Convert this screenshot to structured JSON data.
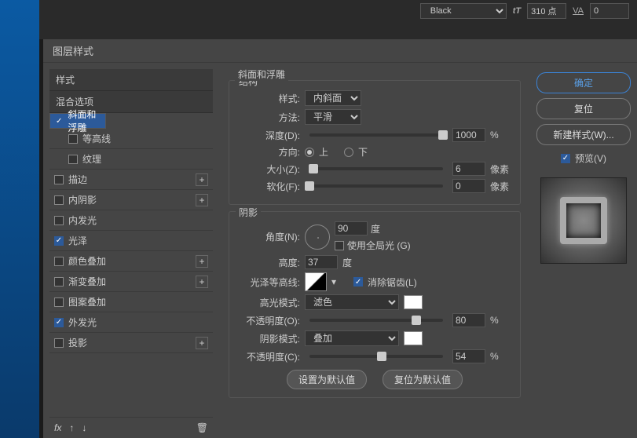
{
  "top": {
    "color_label": "Black",
    "tracking": "310 点",
    "va": "0"
  },
  "dialog_title": "图层样式",
  "left": {
    "styles_header": "样式",
    "blend_header": "混合选项",
    "items": [
      {
        "label": "斜面和浮雕",
        "checked": true,
        "selected": true,
        "indent": false,
        "plus": false
      },
      {
        "label": "等高线",
        "checked": false,
        "selected": false,
        "indent": true,
        "plus": false
      },
      {
        "label": "纹理",
        "checked": false,
        "selected": false,
        "indent": true,
        "plus": false
      },
      {
        "label": "描边",
        "checked": false,
        "selected": false,
        "indent": false,
        "plus": true
      },
      {
        "label": "内阴影",
        "checked": false,
        "selected": false,
        "indent": false,
        "plus": true
      },
      {
        "label": "内发光",
        "checked": false,
        "selected": false,
        "indent": false,
        "plus": false
      },
      {
        "label": "光泽",
        "checked": true,
        "selected": false,
        "indent": false,
        "plus": false
      },
      {
        "label": "颜色叠加",
        "checked": false,
        "selected": false,
        "indent": false,
        "plus": true
      },
      {
        "label": "渐变叠加",
        "checked": false,
        "selected": false,
        "indent": false,
        "plus": true
      },
      {
        "label": "图案叠加",
        "checked": false,
        "selected": false,
        "indent": false,
        "plus": false
      },
      {
        "label": "外发光",
        "checked": true,
        "selected": false,
        "indent": false,
        "plus": false
      },
      {
        "label": "投影",
        "checked": false,
        "selected": false,
        "indent": false,
        "plus": true
      }
    ],
    "fx": "fx"
  },
  "mid": {
    "section_title": "斜面和浮雕",
    "structure_title": "结构",
    "style_label": "样式:",
    "style_value": "内斜面",
    "technique_label": "方法:",
    "technique_value": "平滑",
    "depth_label": "深度(D):",
    "depth_value": "1000",
    "percent": "%",
    "direction_label": "方向:",
    "dir_up": "上",
    "dir_down": "下",
    "size_label": "大小(Z):",
    "size_value": "6",
    "px": "像素",
    "soften_label": "软化(F):",
    "soften_value": "0",
    "shading_title": "阴影",
    "angle_label": "角度(N):",
    "angle_value": "90",
    "deg": "度",
    "global_light": "使用全局光 (G)",
    "altitude_label": "高度:",
    "altitude_value": "37",
    "gloss_label": "光泽等高线:",
    "antialias": "消除锯齿(L)",
    "hmode_label": "高光模式:",
    "hmode_value": "滤色",
    "hopacity_label": "不透明度(O):",
    "hopacity_value": "80",
    "smode_label": "阴影模式:",
    "smode_value": "叠加",
    "sopacity_label": "不透明度(C):",
    "sopacity_value": "54",
    "make_default": "设置为默认值",
    "reset_default": "复位为默认值"
  },
  "right": {
    "ok": "确定",
    "cancel": "复位",
    "new_style": "新建样式(W)...",
    "preview": "预览(V)"
  }
}
